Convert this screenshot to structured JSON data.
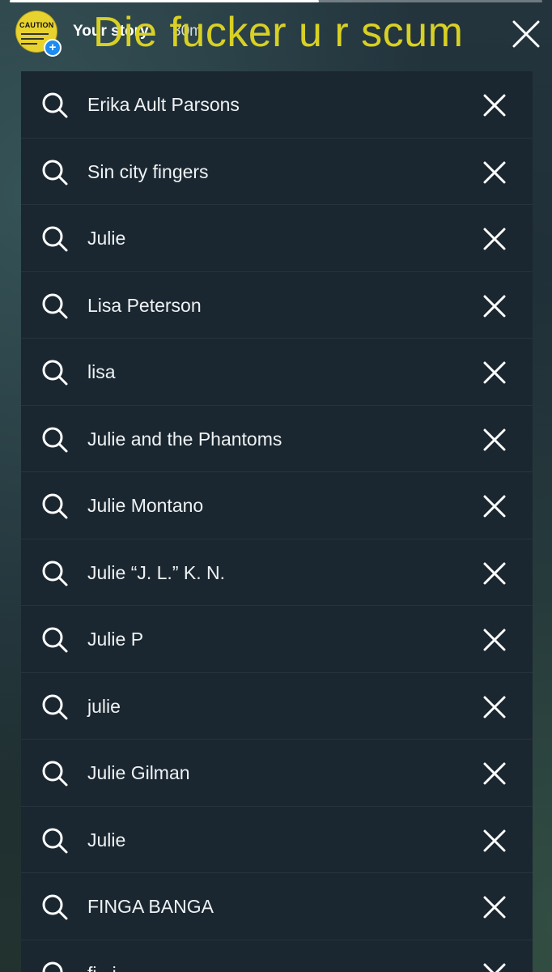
{
  "story_header": {
    "label": "Your story",
    "time": "30m",
    "avatar_text": "CAUTION",
    "overlay_text": "Die fucker u r scum",
    "add_badge": "+"
  },
  "progress": {
    "fraction": 0.58
  },
  "colors": {
    "overlay_text": "#d8d024",
    "badge": "#1d8cf0",
    "panel": "#1b2730"
  },
  "recent_searches": [
    {
      "query": "Erika Ault Parsons"
    },
    {
      "query": "Sin city fingers"
    },
    {
      "query": "Julie"
    },
    {
      "query": "Lisa Peterson"
    },
    {
      "query": "lisa"
    },
    {
      "query": "Julie and the Phantoms"
    },
    {
      "query": "Julie Montano"
    },
    {
      "query": "Julie “J. L.” K. N."
    },
    {
      "query": "Julie P"
    },
    {
      "query": "julie"
    },
    {
      "query": "Julie Gilman"
    },
    {
      "query": "Julie"
    },
    {
      "query": "FINGA BANGA"
    },
    {
      "query": "fi...i..."
    }
  ],
  "icons": {
    "search": "search-icon",
    "remove": "close-icon",
    "dismiss": "close-icon"
  }
}
